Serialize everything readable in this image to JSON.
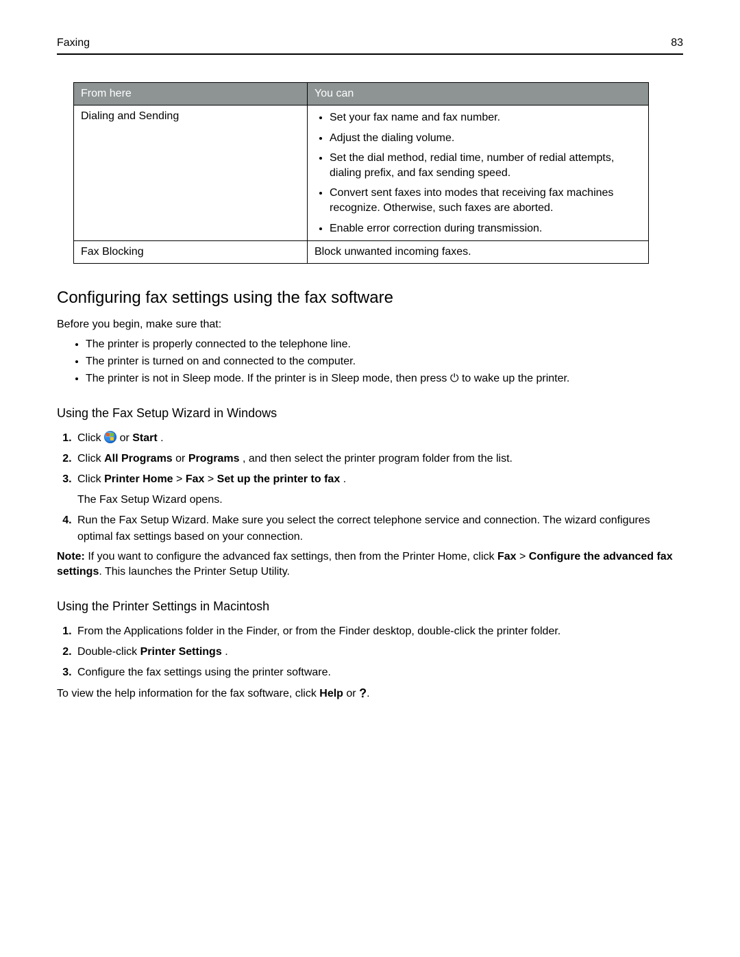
{
  "header": {
    "section": "Faxing",
    "page_number": "83"
  },
  "table": {
    "head_left": "From here",
    "head_right": "You can",
    "row1_left": "Dialing and Sending",
    "row1_items": [
      "Set your fax name and fax number.",
      "Adjust the dialing volume.",
      "Set the dial method, redial time, number of redial attempts, dialing prefix, and fax sending speed.",
      "Convert sent faxes into modes that receiving fax machines recognize. Otherwise, such faxes are aborted.",
      "Enable error correction during transmission."
    ],
    "row2_left": "Fax Blocking",
    "row2_right": "Block unwanted incoming faxes."
  },
  "section_title": "Configuring fax settings using the fax software",
  "intro": "Before you begin, make sure that:",
  "prereqs": [
    "The printer is properly connected to the telephone line.",
    "The printer is turned on and connected to the computer."
  ],
  "prereq3_a": "The printer is not in Sleep mode. If the printer is in Sleep mode, then press ",
  "prereq3_b": " to wake up the printer.",
  "power_icon": "⏻",
  "win_heading": "Using the Fax Setup Wizard in Windows",
  "win_step1_a": "Click ",
  "win_step1_b": " or ",
  "win_step1_c": "Start",
  "win_step1_d": ".",
  "win_step2_a": "Click ",
  "win_step2_b": "All Programs",
  "win_step2_c": " or ",
  "win_step2_d": "Programs",
  "win_step2_e": ", and then select the printer program folder from the list.",
  "win_step3_a": "Click ",
  "win_step3_b": "Printer Home",
  "win_step3_c": " > ",
  "win_step3_d": "Fax",
  "win_step3_e": " > ",
  "win_step3_f": "Set up the printer to fax",
  "win_step3_g": ".",
  "win_step3_sub": "The Fax Setup Wizard opens.",
  "win_step4": "Run the Fax Setup Wizard. Make sure you select the correct telephone service and connection. The wizard configures optimal fax settings based on your connection.",
  "note_a": "Note:",
  "note_b": " If you want to configure the advanced fax settings, then from the Printer Home, click ",
  "note_c": "Fax",
  "note_d": " > ",
  "note_e": "Configure the advanced fax settings",
  "note_f": ". This launches the Printer Setup Utility.",
  "mac_heading": "Using the Printer Settings in Macintosh",
  "mac_step1": "From the Applications folder in the Finder, or from the Finder desktop, double-click the printer folder.",
  "mac_step2_a": "Double-click ",
  "mac_step2_b": "Printer Settings",
  "mac_step2_c": ".",
  "mac_step3": "Configure the fax settings using the printer software.",
  "help_a": "To view the help information for the fax software, click ",
  "help_b": "Help",
  "help_c": " or ",
  "help_d": "."
}
